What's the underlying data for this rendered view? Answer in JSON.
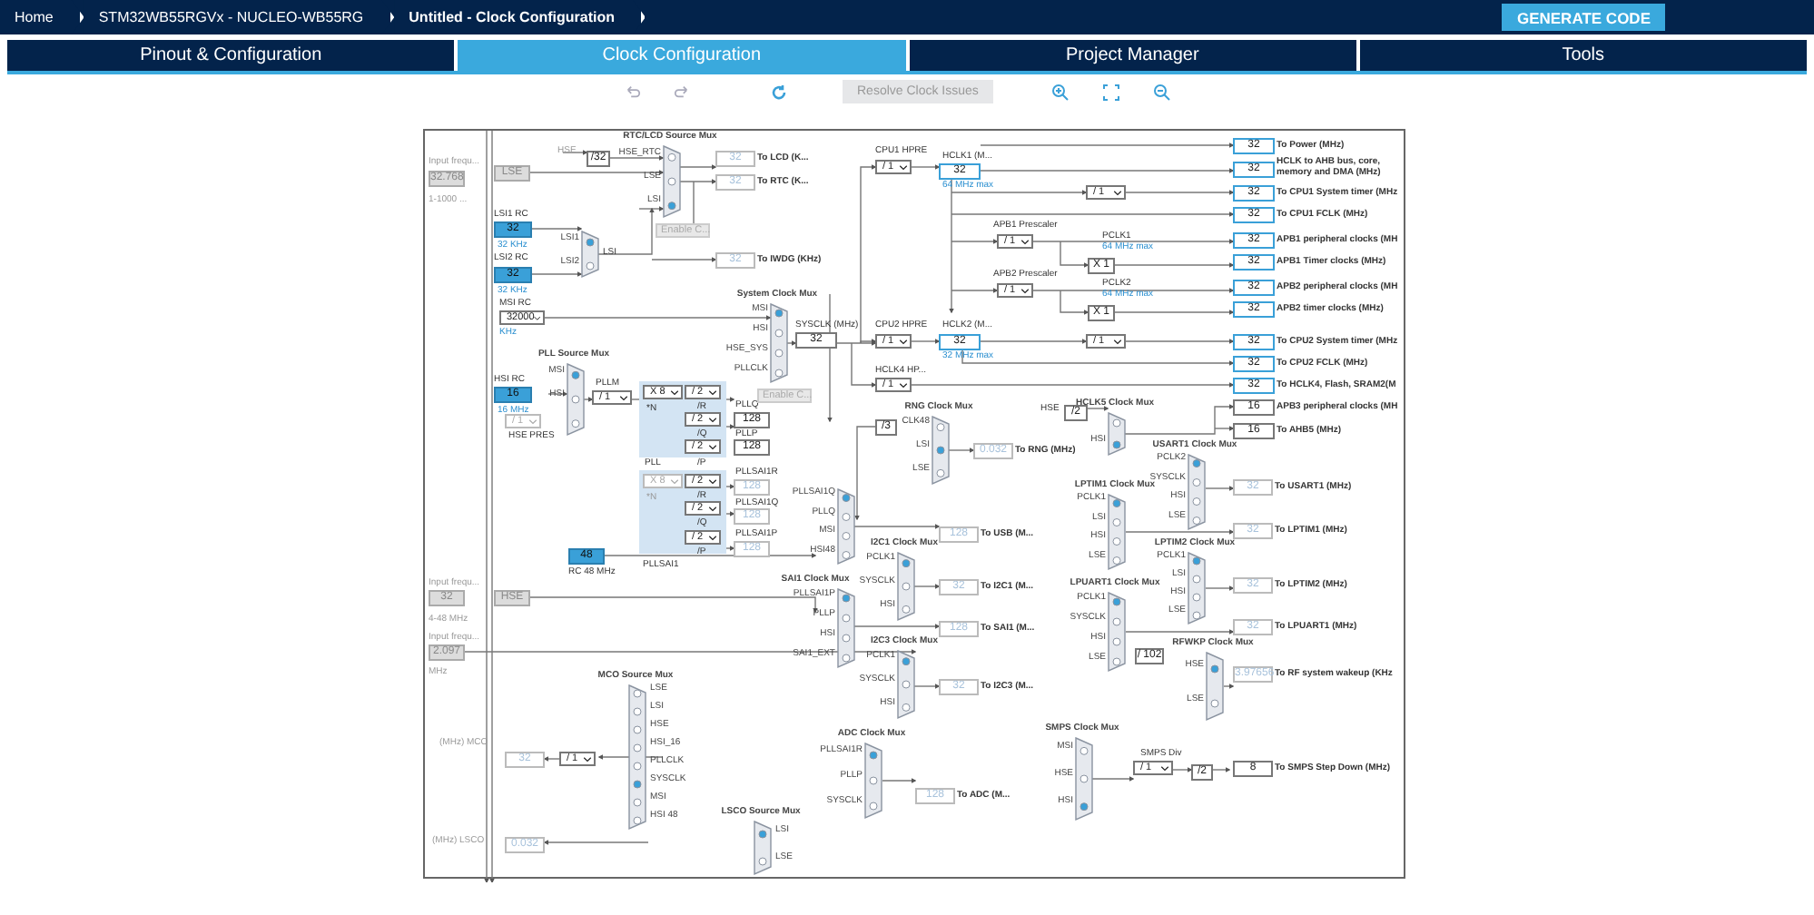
{
  "breadcrumbs": [
    {
      "label": "Home",
      "current": false
    },
    {
      "label": "STM32WB55RGVx  -  NUCLEO-WB55RG",
      "current": false
    },
    {
      "label": "Untitled - Clock Configuration",
      "current": true
    }
  ],
  "generate_button": "GENERATE CODE",
  "tabs": [
    {
      "label": "Pinout & Configuration",
      "selected": false
    },
    {
      "label": "Clock Configuration",
      "selected": true
    },
    {
      "label": "Project Manager",
      "selected": false
    },
    {
      "label": "Tools",
      "selected": false
    }
  ],
  "toolbar": {
    "resolve_button": {
      "label": "Resolve Clock Issues",
      "disabled": true
    }
  },
  "diagram": {
    "texts": [
      {
        "text": "Input frequ...",
        "kind": "hint"
      },
      {
        "text": "1-1000 ...",
        "kind": "hint"
      },
      {
        "text": "HSE",
        "kind": "hint"
      },
      {
        "text": "LSI1 RC",
        "kind": "label"
      },
      {
        "text": "32 KHz",
        "kind": "note"
      },
      {
        "text": "LSI2 RC",
        "kind": "label"
      },
      {
        "text": "32 KHz",
        "kind": "note"
      },
      {
        "text": "LSI",
        "kind": "label"
      },
      {
        "text": "MSI RC",
        "kind": "label"
      },
      {
        "text": "KHz",
        "kind": "note"
      },
      {
        "text": "SYSCLK (MHz)",
        "kind": "label"
      },
      {
        "text": "HSI RC",
        "kind": "label"
      },
      {
        "text": "16 MHz",
        "kind": "note"
      },
      {
        "text": "HSE PRES",
        "kind": "label"
      },
      {
        "text": "PLLM",
        "kind": "label"
      },
      {
        "text": "*N",
        "kind": "label"
      },
      {
        "text": "/R",
        "kind": "label"
      },
      {
        "text": "/Q",
        "kind": "label"
      },
      {
        "text": "PLL",
        "kind": "label"
      },
      {
        "text": "/P",
        "kind": "label"
      },
      {
        "text": "PLLQ",
        "kind": "label"
      },
      {
        "text": "PLLP",
        "kind": "label"
      },
      {
        "text": "*N",
        "kind": "hint"
      },
      {
        "text": "/R",
        "kind": "label"
      },
      {
        "text": "PLLSAI1R",
        "kind": "label"
      },
      {
        "text": "/Q",
        "kind": "label"
      },
      {
        "text": "PLLSAI1Q",
        "kind": "label"
      },
      {
        "text": "PLLSAI1",
        "kind": "label"
      },
      {
        "text": "/P",
        "kind": "label"
      },
      {
        "text": "PLLSAI1P",
        "kind": "label"
      },
      {
        "text": "RC 48 MHz",
        "kind": "label"
      },
      {
        "text": "Input frequ...",
        "kind": "hint"
      },
      {
        "text": "4-48 MHz",
        "kind": "hint"
      },
      {
        "text": "Input frequ...",
        "kind": "hint"
      },
      {
        "text": "MHz",
        "kind": "hint"
      },
      {
        "text": "(MHz) MCO",
        "kind": "hint"
      },
      {
        "text": "(MHz) LSCO",
        "kind": "hint"
      },
      {
        "text": "CPU1 HPRE",
        "kind": "label"
      },
      {
        "text": "HCLK1 (M...",
        "kind": "label"
      },
      {
        "text": "64 MHz max",
        "kind": "note"
      },
      {
        "text": "APB1 Prescaler",
        "kind": "label"
      },
      {
        "text": "PCLK1",
        "kind": "label"
      },
      {
        "text": "64 MHz max",
        "kind": "note"
      },
      {
        "text": "APB2 Prescaler",
        "kind": "label"
      },
      {
        "text": "PCLK2",
        "kind": "label"
      },
      {
        "text": "64 MHz max",
        "kind": "note"
      },
      {
        "text": "CPU2 HPRE",
        "kind": "label"
      },
      {
        "text": "HCLK2 (M...",
        "kind": "label"
      },
      {
        "text": "32 MHz max",
        "kind": "note"
      },
      {
        "text": "HCLK4 HP...",
        "kind": "label"
      },
      {
        "text": "HSE",
        "kind": "label"
      },
      {
        "text": "SMPS Div",
        "kind": "label"
      }
    ],
    "value_boxes": [
      {
        "value": "32.768",
        "kind": "input"
      },
      {
        "value": "LSE",
        "kind": "input"
      },
      {
        "value": "/32",
        "kind": "plain"
      },
      {
        "value": "32",
        "kind": "inactive",
        "label": "To LCD (K..."
      },
      {
        "value": "32",
        "kind": "inactive",
        "label": "To RTC (K..."
      },
      {
        "value": "32",
        "kind": "source"
      },
      {
        "value": "32",
        "kind": "source"
      },
      {
        "value": "32",
        "kind": "inactive",
        "label": "To IWDG (KHz)"
      },
      {
        "value": "32",
        "kind": "plain"
      },
      {
        "value": "16",
        "kind": "source"
      },
      {
        "value": "128",
        "kind": "plain"
      },
      {
        "value": "128",
        "kind": "plain"
      },
      {
        "value": "128",
        "kind": "inactive"
      },
      {
        "value": "128",
        "kind": "inactive"
      },
      {
        "value": "128",
        "kind": "inactive"
      },
      {
        "value": "48",
        "kind": "source"
      },
      {
        "value": "32",
        "kind": "input"
      },
      {
        "value": "HSE",
        "kind": "input"
      },
      {
        "value": "2.097",
        "kind": "input"
      },
      {
        "value": "32",
        "kind": "inactive"
      },
      {
        "value": "0.032",
        "kind": "inactive"
      },
      {
        "value": "32",
        "kind": "active"
      },
      {
        "value": "X 1",
        "kind": "plain"
      },
      {
        "value": "X 1",
        "kind": "plain"
      },
      {
        "value": "32",
        "kind": "active"
      },
      {
        "value": "32",
        "kind": "active",
        "label": "To Power (MHz)"
      },
      {
        "value": "32",
        "kind": "active",
        "label": "HCLK to AHB bus, core, memory and DMA (MHz)"
      },
      {
        "value": "32",
        "kind": "active",
        "label": "To CPU1 System timer (MHz"
      },
      {
        "value": "32",
        "kind": "active",
        "label": "To CPU1 FCLK (MHz)"
      },
      {
        "value": "32",
        "kind": "active",
        "label": "APB1 peripheral clocks (MH"
      },
      {
        "value": "32",
        "kind": "active",
        "label": "APB1 Timer clocks (MHz)"
      },
      {
        "value": "32",
        "kind": "active",
        "label": "APB2 peripheral clocks (MH"
      },
      {
        "value": "32",
        "kind": "active",
        "label": "APB2 timer clocks (MHz)"
      },
      {
        "value": "32",
        "kind": "active",
        "label": "To CPU2 System timer (MHz"
      },
      {
        "value": "32",
        "kind": "active",
        "label": "To CPU2 FCLK (MHz)"
      },
      {
        "value": "32",
        "kind": "active",
        "label": "To HCLK4, Flash, SRAM2(M"
      },
      {
        "value": "/2",
        "kind": "plain"
      },
      {
        "value": "16",
        "kind": "plain",
        "label": "APB3 peripheral clocks (MH"
      },
      {
        "value": "16",
        "kind": "plain",
        "label": "To AHB5 (MHz)"
      },
      {
        "value": "/3",
        "kind": "plain"
      },
      {
        "value": "0.032",
        "kind": "inactive",
        "label": "To RNG (MHz)"
      },
      {
        "value": "128",
        "kind": "inactive",
        "label": "To USB (M..."
      },
      {
        "value": "32",
        "kind": "inactive",
        "label": "To I2C1 (M..."
      },
      {
        "value": "128",
        "kind": "inactive",
        "label": "To SAI1 (M..."
      },
      {
        "value": "32",
        "kind": "inactive",
        "label": "To I2C3 (M..."
      },
      {
        "value": "32",
        "kind": "inactive",
        "label": "To USART1 (MHz)"
      },
      {
        "value": "32",
        "kind": "inactive",
        "label": "To LPTIM1 (MHz)"
      },
      {
        "value": "32",
        "kind": "inactive",
        "label": "To LPTIM2 (MHz)"
      },
      {
        "value": "32",
        "kind": "inactive",
        "label": "To LPUART1 (MHz)"
      },
      {
        "value": "/ 102",
        "kind": "plain"
      },
      {
        "value": "3.97656",
        "kind": "inactive",
        "label": "To RF system wakeup (KHz"
      },
      {
        "value": "128",
        "kind": "inactive",
        "label": "To ADC (M..."
      },
      {
        "value": "/2",
        "kind": "plain"
      },
      {
        "value": "8",
        "kind": "plain",
        "label": "To SMPS Step Down (MHz)"
      }
    ],
    "selects": [
      {
        "value": "/ 1",
        "disabled": false
      },
      {
        "value": "32000",
        "disabled": false
      },
      {
        "value": "/ 1",
        "disabled": true
      },
      {
        "value": "/ 1",
        "disabled": false
      },
      {
        "value": "X 8",
        "disabled": false
      },
      {
        "value": "/ 2",
        "disabled": false
      },
      {
        "value": "/ 2",
        "disabled": false
      },
      {
        "value": "/ 2",
        "disabled": false
      },
      {
        "value": "X 8",
        "disabled": true
      },
      {
        "value": "/ 2",
        "disabled": false
      },
      {
        "value": "/ 2",
        "disabled": false
      },
      {
        "value": "/ 2",
        "disabled": false
      },
      {
        "value": "/ 1",
        "disabled": false
      },
      {
        "value": "/ 1",
        "disabled": false
      },
      {
        "value": "/ 1",
        "disabled": false
      },
      {
        "value": "/ 1",
        "disabled": false
      },
      {
        "value": "/ 1",
        "disabled": false
      },
      {
        "value": "/ 1",
        "disabled": false
      },
      {
        "value": "/ 1",
        "disabled": false
      },
      {
        "value": "/ 1",
        "disabled": false
      }
    ],
    "muxes": [
      {
        "title": "RTC/LCD Source Mux",
        "inputs": [
          {
            "label": "HSE_RTC",
            "selected": false
          },
          {
            "label": "LSE",
            "selected": false
          },
          {
            "label": "LSI",
            "selected": true
          }
        ]
      },
      {
        "inputs": [
          {
            "label": "LSI1",
            "selected": true
          },
          {
            "label": "LSI2",
            "selected": false
          }
        ]
      },
      {
        "title": "System Clock Mux",
        "inputs": [
          {
            "label": "MSI",
            "selected": true
          },
          {
            "label": "HSI",
            "selected": false
          },
          {
            "label": "HSE_SYS",
            "selected": false
          },
          {
            "label": "PLLCLK",
            "selected": false
          }
        ]
      },
      {
        "title": "PLL Source Mux",
        "inputs": [
          {
            "label": "MSI",
            "selected": true
          },
          {
            "label": "HSI",
            "selected": false
          },
          {
            "selected": false
          }
        ]
      },
      {
        "title": "MCO Source Mux",
        "inputs": [
          {
            "label": "LSE",
            "selected": false
          },
          {
            "label": "LSI",
            "selected": false
          },
          {
            "label": "HSE",
            "selected": false
          },
          {
            "label": "HSI_16",
            "selected": false
          },
          {
            "label": "PLLCLK",
            "selected": false
          },
          {
            "label": "SYSCLK",
            "selected": true
          },
          {
            "label": "MSI",
            "selected": false
          },
          {
            "label": "HSI 48",
            "selected": false
          }
        ]
      },
      {
        "title": "LSCO Source Mux",
        "inputs": [
          {
            "label": "LSI",
            "selected": true
          },
          {
            "label": "LSE",
            "selected": false
          }
        ]
      },
      {
        "title": "RNG Clock Mux",
        "inputs": [
          {
            "label": "CLK48",
            "selected": false
          },
          {
            "label": "LSI",
            "selected": true
          },
          {
            "label": "LSE",
            "selected": false
          }
        ]
      },
      {
        "title": "HCLK5 Clock Mux",
        "inputs": [
          {
            "selected": false
          },
          {
            "label": "HSI",
            "selected": true
          }
        ]
      },
      {
        "inputs": [
          {
            "label": "PLLSAI1Q",
            "selected": true
          },
          {
            "label": "PLLQ",
            "selected": false
          },
          {
            "label": "MSI",
            "selected": false
          },
          {
            "label": "HSI48",
            "selected": false
          }
        ]
      },
      {
        "title": "I2C1 Clock Mux",
        "inputs": [
          {
            "label": "PCLK1",
            "selected": true
          },
          {
            "label": "SYSCLK",
            "selected": false
          },
          {
            "label": "HSI",
            "selected": false
          }
        ]
      },
      {
        "title": "SAI1 Clock Mux",
        "inputs": [
          {
            "label": "PLLSAI1P",
            "selected": true
          },
          {
            "label": "PLLP",
            "selected": false
          },
          {
            "label": "HSI",
            "selected": false
          },
          {
            "label": "SAI1_EXT",
            "selected": false
          }
        ]
      },
      {
        "title": "I2C3 Clock Mux",
        "inputs": [
          {
            "label": "PCLK1",
            "selected": true
          },
          {
            "label": "SYSCLK",
            "selected": false
          },
          {
            "label": "HSI",
            "selected": false
          }
        ]
      },
      {
        "title": "USART1 Clock Mux",
        "inputs": [
          {
            "label": "PCLK2",
            "selected": true
          },
          {
            "label": "SYSCLK",
            "selected": false
          },
          {
            "label": "HSI",
            "selected": false
          },
          {
            "label": "LSE",
            "selected": false
          }
        ]
      },
      {
        "title": "LPTIM1 Clock Mux",
        "inputs": [
          {
            "label": "PCLK1",
            "selected": true
          },
          {
            "label": "LSI",
            "selected": false
          },
          {
            "label": "HSI",
            "selected": false
          },
          {
            "label": "LSE",
            "selected": false
          }
        ]
      },
      {
        "title": "LPTIM2 Clock Mux",
        "inputs": [
          {
            "label": "PCLK1",
            "selected": true
          },
          {
            "label": "LSI",
            "selected": false
          },
          {
            "label": "HSI",
            "selected": false
          },
          {
            "label": "LSE",
            "selected": false
          }
        ]
      },
      {
        "title": "LPUART1 Clock Mux",
        "inputs": [
          {
            "label": "PCLK1",
            "selected": true
          },
          {
            "label": "SYSCLK",
            "selected": false
          },
          {
            "label": "HSI",
            "selected": false
          },
          {
            "label": "LSE",
            "selected": false
          }
        ]
      },
      {
        "title": "RFWKP Clock Mux",
        "inputs": [
          {
            "label": "HSE",
            "selected": true
          },
          {
            "label": "LSE",
            "selected": false
          }
        ]
      },
      {
        "title": "ADC Clock Mux",
        "inputs": [
          {
            "label": "PLLSAI1R",
            "selected": true
          },
          {
            "label": "PLLP",
            "selected": false
          },
          {
            "label": "SYSCLK",
            "selected": false
          }
        ]
      },
      {
        "title": "SMPS Clock Mux",
        "inputs": [
          {
            "label": "MSI",
            "selected": false
          },
          {
            "label": "HSE",
            "selected": false
          },
          {
            "label": "HSI",
            "selected": true
          }
        ]
      }
    ],
    "buttons": [
      {
        "label": "Enable C...",
        "disabled": true
      },
      {
        "label": "Enable C...",
        "disabled": true
      }
    ]
  }
}
